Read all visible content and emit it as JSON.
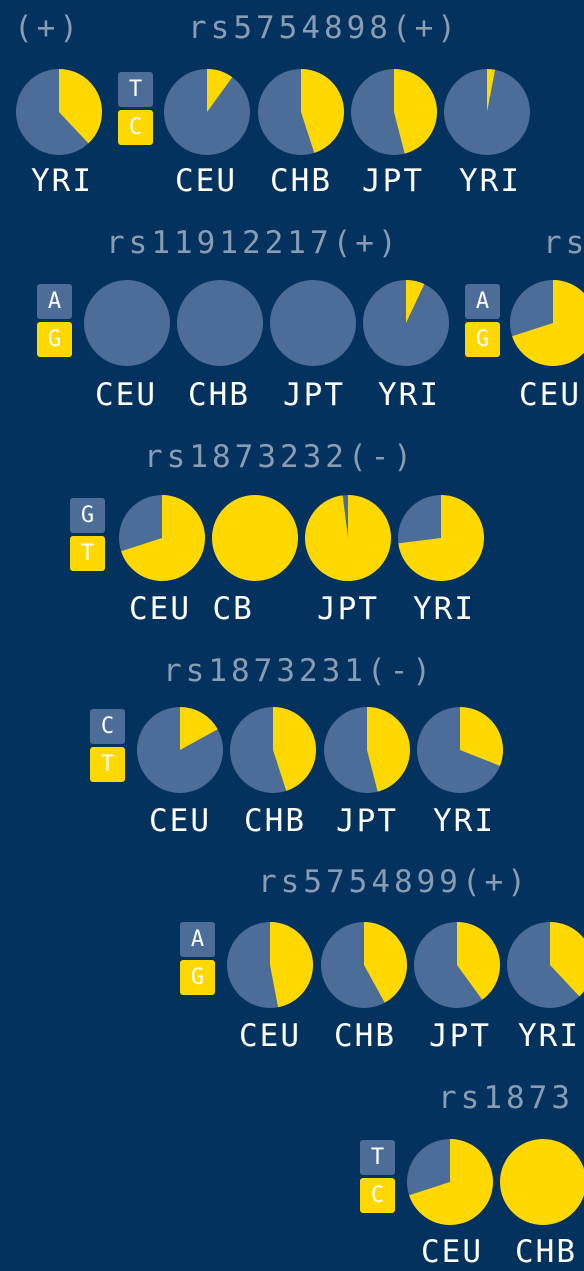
{
  "colors": {
    "background": "#03325f",
    "major": "#4c6d97",
    "minor": "#ffd800",
    "label": "#8a9cb1",
    "text": "#ffffff"
  },
  "chart_data": [
    {
      "type": "pie",
      "title": "(+)",
      "alleles": [],
      "populations": [
        {
          "label": "YRI",
          "fraction": 0.38
        }
      ]
    },
    {
      "type": "pie",
      "title": "rs5754898(+)",
      "alleles": [
        "T",
        "C"
      ],
      "populations": [
        {
          "label": "CEU",
          "fraction": 0.1
        },
        {
          "label": "CHB",
          "fraction": 0.45
        },
        {
          "label": "JPT",
          "fraction": 0.46
        },
        {
          "label": "YRI",
          "fraction": 0.03
        }
      ]
    },
    {
      "type": "pie",
      "title": "rs11912217(+)",
      "alleles": [
        "A",
        "G"
      ],
      "populations": [
        {
          "label": "CEU",
          "fraction": 0.0
        },
        {
          "label": "CHB",
          "fraction": 0.0
        },
        {
          "label": "JPT",
          "fraction": 0.0
        },
        {
          "label": "YRI",
          "fraction": 0.07
        }
      ]
    },
    {
      "type": "pie",
      "title": "rs",
      "alleles": [
        "A",
        "G"
      ],
      "populations": [
        {
          "label": "CEU",
          "fraction": 0.7
        }
      ]
    },
    {
      "type": "pie",
      "title": "rs1873232(-)",
      "alleles": [
        "G",
        "T"
      ],
      "populations": [
        {
          "label": "CEU",
          "fraction": 0.7
        },
        {
          "label": "CB",
          "fraction": 1.0
        },
        {
          "label": "JPT",
          "fraction": 0.98
        },
        {
          "label": "YRI",
          "fraction": 0.73
        }
      ]
    },
    {
      "type": "pie",
      "title": "rs1873231(-)",
      "alleles": [
        "C",
        "T"
      ],
      "populations": [
        {
          "label": "CEU",
          "fraction": 0.17
        },
        {
          "label": "CHB",
          "fraction": 0.45
        },
        {
          "label": "JPT",
          "fraction": 0.46
        },
        {
          "label": "YRI",
          "fraction": 0.31
        }
      ]
    },
    {
      "type": "pie",
      "title": "rs5754899(+)",
      "alleles": [
        "A",
        "G"
      ],
      "populations": [
        {
          "label": "CEU",
          "fraction": 0.47
        },
        {
          "label": "CHB",
          "fraction": 0.42
        },
        {
          "label": "JPT",
          "fraction": 0.4
        },
        {
          "label": "YRI",
          "fraction": 0.38
        }
      ]
    },
    {
      "type": "pie",
      "title": "rs1873",
      "alleles": [
        "T",
        "C"
      ],
      "populations": [
        {
          "label": "CEU",
          "fraction": 0.7
        },
        {
          "label": "CHB",
          "fraction": 1.0
        }
      ]
    }
  ]
}
